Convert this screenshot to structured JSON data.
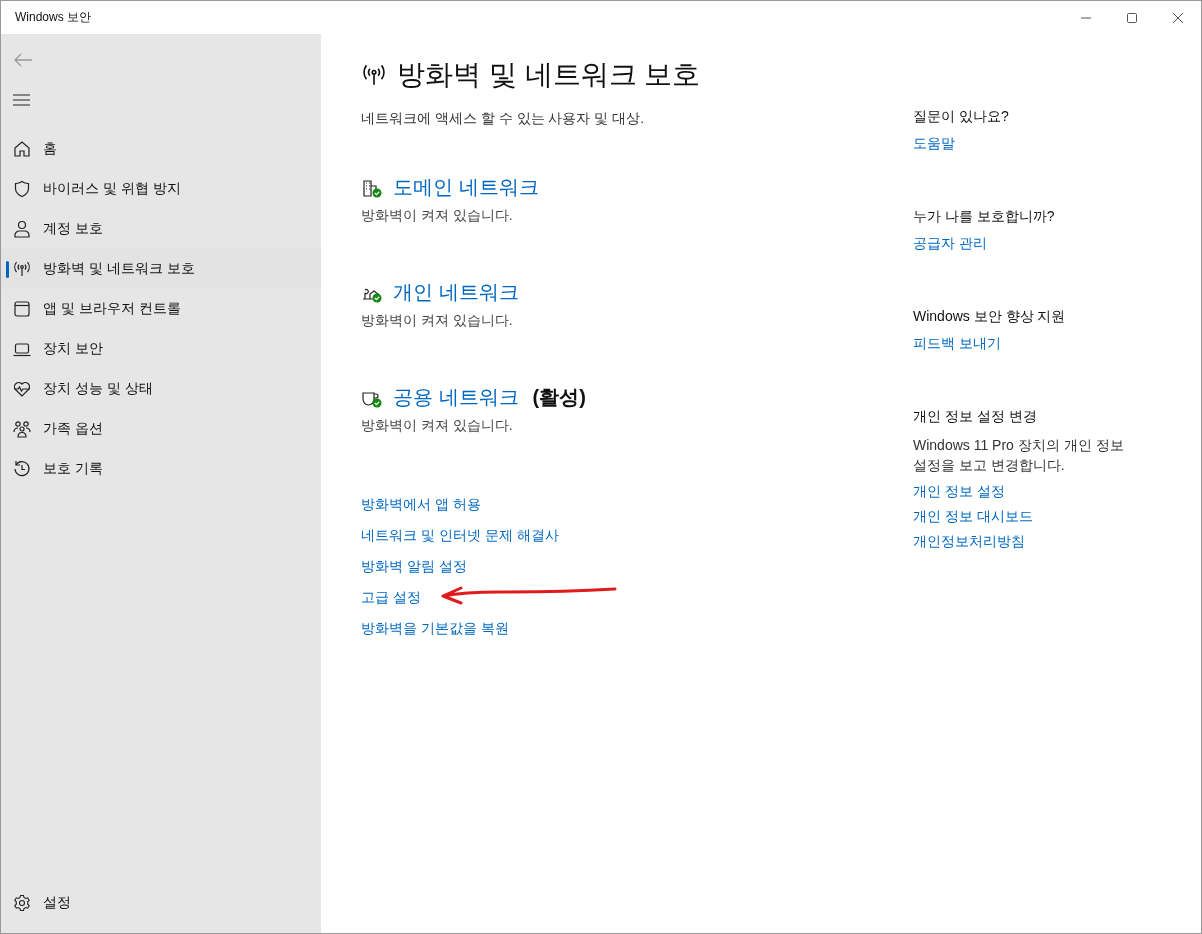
{
  "window": {
    "title": "Windows 보안"
  },
  "sidebar": {
    "items": [
      {
        "kind": "home",
        "label": "홈",
        "selected": false
      },
      {
        "kind": "shield",
        "label": "바이러스 및 위협 방지",
        "selected": false
      },
      {
        "kind": "person",
        "label": "계정 보호",
        "selected": false
      },
      {
        "kind": "antenna",
        "label": "방화벽 및 네트워크 보호",
        "selected": true
      },
      {
        "kind": "window",
        "label": "앱 및 브라우저 컨트롤",
        "selected": false
      },
      {
        "kind": "laptop",
        "label": "장치 보안",
        "selected": false
      },
      {
        "kind": "heart",
        "label": "장치 성능 및 상태",
        "selected": false
      },
      {
        "kind": "family",
        "label": "가족 옵션",
        "selected": false
      },
      {
        "kind": "history",
        "label": "보호 기록",
        "selected": false
      }
    ],
    "settings": "설정"
  },
  "page": {
    "title": "방화벽 및 네트워크 보호",
    "subtitle": "네트워크에 액세스 할 수 있는 사용자 및 대상.",
    "networks": [
      {
        "kind": "domain",
        "name": "도메인 네트워크",
        "status": "방화벽이 켜져 있습니다."
      },
      {
        "kind": "private",
        "name": "개인 네트워크",
        "status": "방화벽이 켜져 있습니다."
      },
      {
        "kind": "public",
        "name": "공용 네트워크",
        "badge": "(활성)",
        "status": "방화벽이 켜져 있습니다."
      }
    ],
    "links": [
      "방화벽에서 앱 허용",
      "네트워크 및 인터넷 문제 해결사",
      "방화벽 알림 설정",
      "고급 설정",
      "방화벽을 기본값을 복원"
    ]
  },
  "aside": [
    {
      "heading": "질문이 있나요?",
      "links": [
        "도움말"
      ]
    },
    {
      "heading": "누가 나를 보호합니까?",
      "links": [
        "공급자 관리"
      ]
    },
    {
      "heading": "Windows 보안 향상 지원",
      "links": [
        "피드백 보내기"
      ]
    },
    {
      "heading": "개인 정보 설정 변경",
      "text": "Windows 11 Pro 장치의 개인 정보 설정을 보고 변경합니다.",
      "links": [
        "개인 정보 설정",
        "개인 정보 대시보드",
        "개인정보처리방침"
      ]
    }
  ]
}
